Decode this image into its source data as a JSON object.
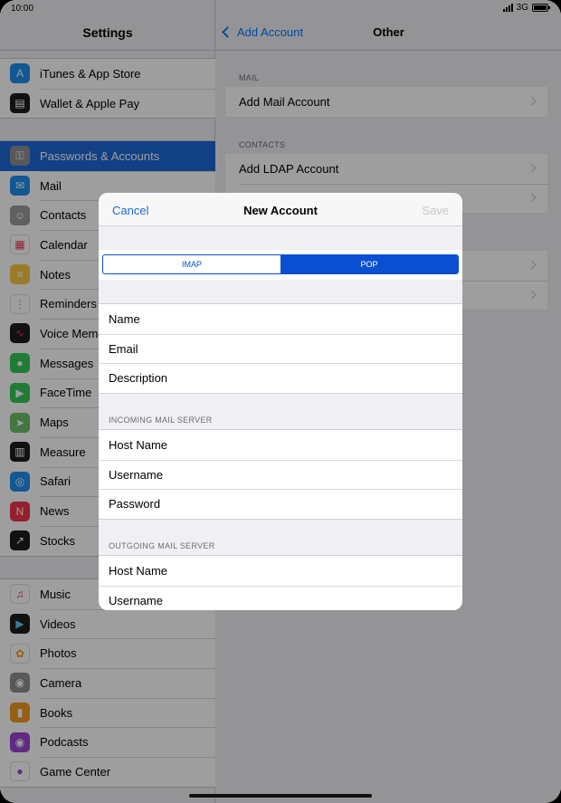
{
  "status_bar": {
    "time": "10:00",
    "network": "3G"
  },
  "settings": {
    "title": "Settings",
    "groups": [
      [
        {
          "label": "iTunes & App Store",
          "icon": "app-store-icon",
          "color": "#1e8ef0",
          "glyph": "A"
        },
        {
          "label": "Wallet & Apple Pay",
          "icon": "wallet-icon",
          "color": "#1c1c1e",
          "glyph": "▤"
        }
      ],
      [
        {
          "label": "Passwords & Accounts",
          "icon": "key-icon",
          "color": "#8e8e93",
          "glyph": "⚿",
          "selected": true
        },
        {
          "label": "Mail",
          "icon": "mail-icon",
          "color": "#1e8ef0",
          "glyph": "✉"
        },
        {
          "label": "Contacts",
          "icon": "contacts-icon",
          "color": "#9b9ba1",
          "glyph": "☺"
        },
        {
          "label": "Calendar",
          "icon": "calendar-icon",
          "color": "#ffffff",
          "glyph": "▦"
        },
        {
          "label": "Notes",
          "icon": "notes-icon",
          "color": "#f7c844",
          "glyph": "≡"
        },
        {
          "label": "Reminders",
          "icon": "reminders-icon",
          "color": "#ffffff",
          "glyph": "⋮"
        },
        {
          "label": "Voice Memos",
          "icon": "voice-memos-icon",
          "color": "#1c1c1e",
          "glyph": "∿"
        },
        {
          "label": "Messages",
          "icon": "messages-icon",
          "color": "#34c759",
          "glyph": "●"
        },
        {
          "label": "FaceTime",
          "icon": "facetime-icon",
          "color": "#34c759",
          "glyph": "▶"
        },
        {
          "label": "Maps",
          "icon": "maps-icon",
          "color": "#6dbf6a",
          "glyph": "➤"
        },
        {
          "label": "Measure",
          "icon": "measure-icon",
          "color": "#1c1c1e",
          "glyph": "▥"
        },
        {
          "label": "Safari",
          "icon": "safari-icon",
          "color": "#1e8ef0",
          "glyph": "◎"
        },
        {
          "label": "News",
          "icon": "news-icon",
          "color": "#f0324b",
          "glyph": "N"
        },
        {
          "label": "Stocks",
          "icon": "stocks-icon",
          "color": "#1c1c1e",
          "glyph": "↗"
        }
      ],
      [
        {
          "label": "Music",
          "icon": "music-icon",
          "color": "#ffffff",
          "glyph": "♫"
        },
        {
          "label": "Videos",
          "icon": "videos-icon",
          "color": "#1c1c1e",
          "glyph": "▶"
        },
        {
          "label": "Photos",
          "icon": "photos-icon",
          "color": "#ffffff",
          "glyph": "✿"
        },
        {
          "label": "Camera",
          "icon": "camera-icon",
          "color": "#8e8e93",
          "glyph": "◉"
        },
        {
          "label": "Books",
          "icon": "books-icon",
          "color": "#f29a1f",
          "glyph": "▮"
        },
        {
          "label": "Podcasts",
          "icon": "podcasts-icon",
          "color": "#9b45d6",
          "glyph": "◉"
        },
        {
          "label": "Game Center",
          "icon": "game-center-icon",
          "color": "#ffffff",
          "glyph": "●"
        }
      ]
    ]
  },
  "detail": {
    "back_label": "Add Account",
    "title": "Other",
    "mail_header": "MAIL",
    "mail_rows": [
      "Add Mail Account"
    ],
    "contacts_header": "CONTACTS",
    "contacts_rows": [
      "Add LDAP Account"
    ]
  },
  "modal": {
    "cancel": "Cancel",
    "title": "New Account",
    "save": "Save",
    "segments": [
      "IMAP",
      "POP"
    ],
    "selected_segment": "POP",
    "account_fields": [
      "Name",
      "Email",
      "Description"
    ],
    "incoming_header": "INCOMING MAIL SERVER",
    "incoming_fields": [
      "Host Name",
      "Username",
      "Password"
    ],
    "outgoing_header": "OUTGOING MAIL SERVER",
    "outgoing_fields": [
      "Host Name",
      "Username"
    ]
  },
  "colors": {
    "accent": "#1e68d6",
    "segment": "#0a4fd1"
  }
}
